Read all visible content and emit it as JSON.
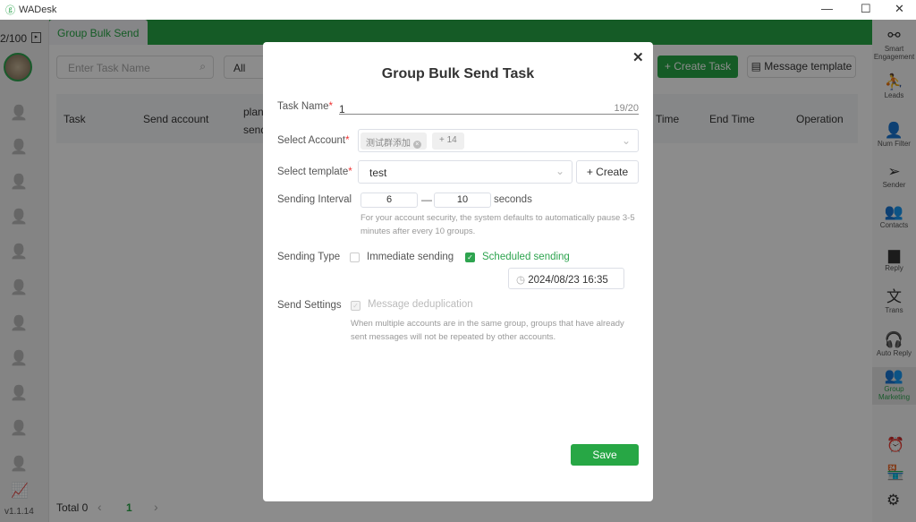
{
  "window": {
    "title": "WADesk",
    "minimize": "—",
    "maximize": "☐",
    "close": "✕"
  },
  "leftbar": {
    "count": "2/100",
    "version": "v1.1.14"
  },
  "tab": {
    "label": "Group Bulk Send"
  },
  "toolbar": {
    "search_placeholder": "Enter Task Name",
    "filter": "All",
    "create_task": "+ Create Task",
    "message_template": "Message template"
  },
  "table": {
    "columns": [
      "Task",
      "Send account",
      "plan send",
      "Time",
      "End Time",
      "Operation"
    ]
  },
  "footer": {
    "total": "Total 0",
    "page": "1",
    "prev": "‹",
    "next": "›"
  },
  "rightbar": {
    "items": [
      {
        "label": "Smart Engagement",
        "icon": "share-icon"
      },
      {
        "label": "Leads",
        "icon": "person-pin-icon"
      },
      {
        "label": "Num Filter",
        "icon": "person-search-icon"
      },
      {
        "label": "Sender",
        "icon": "send-icon"
      },
      {
        "label": "Contacts",
        "icon": "contacts-icon"
      },
      {
        "label": "Reply",
        "icon": "chat-icon"
      },
      {
        "label": "Trans",
        "icon": "translate-icon"
      },
      {
        "label": "Auto Reply",
        "icon": "headset-icon"
      },
      {
        "label": "Group Marketing",
        "icon": "group-icon"
      }
    ]
  },
  "modal": {
    "title": "Group Bulk Send Task",
    "close": "✕",
    "task_name_label": "Task Name",
    "task_name_value": "1",
    "task_name_count": "19/20",
    "account_label": "Select Account",
    "account_tag": "测试群添加",
    "account_more": "+ 14",
    "template_label": "Select template",
    "template_value": "test",
    "create_label": "+ Create",
    "interval_label": "Sending Interval",
    "interval_min": "6",
    "interval_sep": "—",
    "interval_max": "10",
    "interval_unit": "seconds",
    "interval_hint": "For your account security, the system defaults to automatically pause 3-5 minutes after every 10 groups.",
    "type_label": "Sending Type",
    "immediate": "Immediate sending",
    "scheduled": "Scheduled sending",
    "scheduled_checked": true,
    "immediate_checked": false,
    "datetime": "2024/08/23 16:35",
    "settings_label": "Send Settings",
    "dedup": "Message deduplication",
    "dedup_checked": true,
    "dedup_hint": "When multiple accounts are in the same group, groups that have already sent messages will not be repeated by other accounts.",
    "save": "Save",
    "accent": "#2ea44f"
  }
}
